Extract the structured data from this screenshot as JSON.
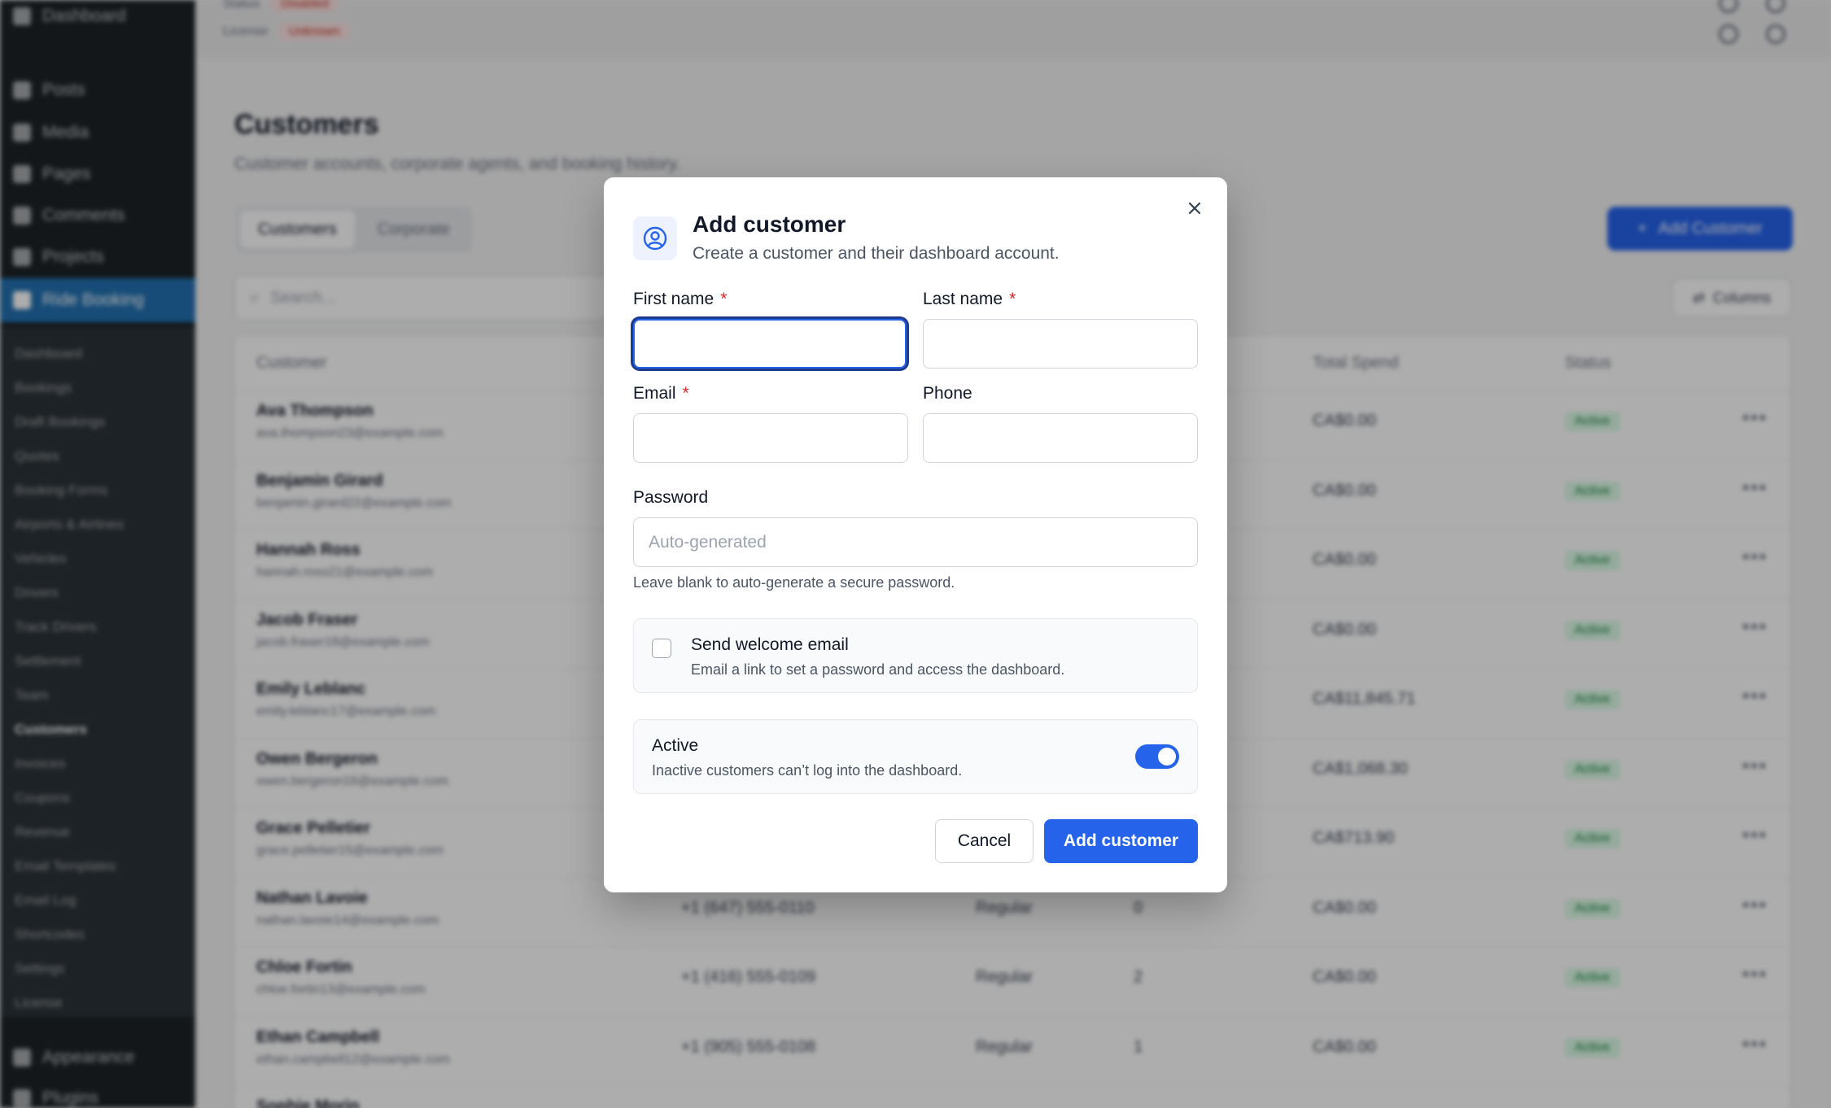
{
  "sidebar": {
    "top_items": [
      {
        "label": "Dashboard",
        "icon": "dashboard-icon"
      },
      {
        "label": "Posts",
        "icon": "pin-icon"
      },
      {
        "label": "Media",
        "icon": "media-icon"
      },
      {
        "label": "Pages",
        "icon": "page-icon"
      },
      {
        "label": "Comments",
        "icon": "comment-icon"
      },
      {
        "label": "Projects",
        "icon": "pin-icon"
      },
      {
        "label": "Ride Booking",
        "icon": "car-icon"
      }
    ],
    "sub_items": [
      "Dashboard",
      "Bookings",
      "Draft Bookings",
      "Quotes",
      "Booking Forms",
      "Airports & Airlines",
      "Vehicles",
      "Drivers",
      "Track Drivers",
      "Settlement",
      "Team",
      "Customers",
      "Invoices",
      "Coupons",
      "Revenue",
      "Email Templates",
      "Email Log",
      "Shortcodes",
      "Settings",
      "License"
    ],
    "bottom_items": [
      {
        "label": "Appearance",
        "icon": "brush-icon"
      },
      {
        "label": "Plugins",
        "icon": "plugin-icon"
      }
    ]
  },
  "topbar": {
    "status_label": "Status",
    "status_value": "Disabled",
    "license_label": "License",
    "license_value": "Unknown"
  },
  "page": {
    "title": "Customers",
    "subtitle": "Customer accounts, corporate agents, and booking history.",
    "tabs": [
      "Customers",
      "Corporate"
    ],
    "add_button": "Add Customer",
    "search_placeholder": "Search...",
    "columns_button": "Columns"
  },
  "table": {
    "headers": {
      "customer": "Customer",
      "total_spend": "Total Spend",
      "status": "Status"
    },
    "rows": [
      {
        "name": "Ava Thompson",
        "email": "ava.thompson23@example.com",
        "phone": "",
        "type": "",
        "bookings": "",
        "spend": "CA$0.00",
        "status": "Active"
      },
      {
        "name": "Benjamin Girard",
        "email": "benjamin.girard22@example.com",
        "phone": "",
        "type": "",
        "bookings": "",
        "spend": "CA$0.00",
        "status": "Active"
      },
      {
        "name": "Hannah Ross",
        "email": "hannah.ross21@example.com",
        "phone": "",
        "type": "",
        "bookings": "",
        "spend": "CA$0.00",
        "status": "Active"
      },
      {
        "name": "Jacob Fraser",
        "email": "jacob.fraser18@example.com",
        "phone": "",
        "type": "",
        "bookings": "",
        "spend": "CA$0.00",
        "status": "Active"
      },
      {
        "name": "Emily Leblanc",
        "email": "emily.leblanc17@example.com",
        "phone": "",
        "type": "",
        "bookings": "",
        "spend": "CA$11,845.71",
        "status": "Active"
      },
      {
        "name": "Owen Bergeron",
        "email": "owen.bergeron16@example.com",
        "phone": "",
        "type": "",
        "bookings": "",
        "spend": "CA$1,068.30",
        "status": "Active"
      },
      {
        "name": "Grace Pelletier",
        "email": "grace.pelletier15@example.com",
        "phone": "",
        "type": "",
        "bookings": "",
        "spend": "CA$713.90",
        "status": "Active"
      },
      {
        "name": "Nathan Lavoie",
        "email": "nathan.lavoie14@example.com",
        "phone": "+1 (647) 555-0110",
        "type": "Regular",
        "bookings": "0",
        "spend": "CA$0.00",
        "status": "Active"
      },
      {
        "name": "Chloe Fortin",
        "email": "chloe.fortin13@example.com",
        "phone": "+1 (416) 555-0109",
        "type": "Regular",
        "bookings": "2",
        "spend": "CA$0.00",
        "status": "Active"
      },
      {
        "name": "Ethan Campbell",
        "email": "ethan.campbell12@example.com",
        "phone": "+1 (905) 555-0108",
        "type": "Regular",
        "bookings": "1",
        "spend": "CA$0.00",
        "status": "Active"
      },
      {
        "name": "Sophie Morin",
        "email": "",
        "phone": "",
        "type": "",
        "bookings": "",
        "spend": "",
        "status": ""
      }
    ]
  },
  "modal": {
    "title": "Add customer",
    "description": "Create a customer and their dashboard account.",
    "first_name_label": "First name",
    "last_name_label": "Last name",
    "email_label": "Email",
    "phone_label": "Phone",
    "password_label": "Password",
    "password_placeholder": "Auto-generated",
    "password_help": "Leave blank to auto-generate a secure password.",
    "required_mark": "*",
    "welcome_title": "Send welcome email",
    "welcome_desc": "Email a link to set a password and access the dashboard.",
    "active_title": "Active",
    "active_desc": "Inactive customers can’t log into the dashboard.",
    "cancel_label": "Cancel",
    "submit_label": "Add customer"
  },
  "colors": {
    "primary": "#2563eb",
    "danger": "#dc2626",
    "sidebar": "#1d2327",
    "success": "#15803d"
  }
}
